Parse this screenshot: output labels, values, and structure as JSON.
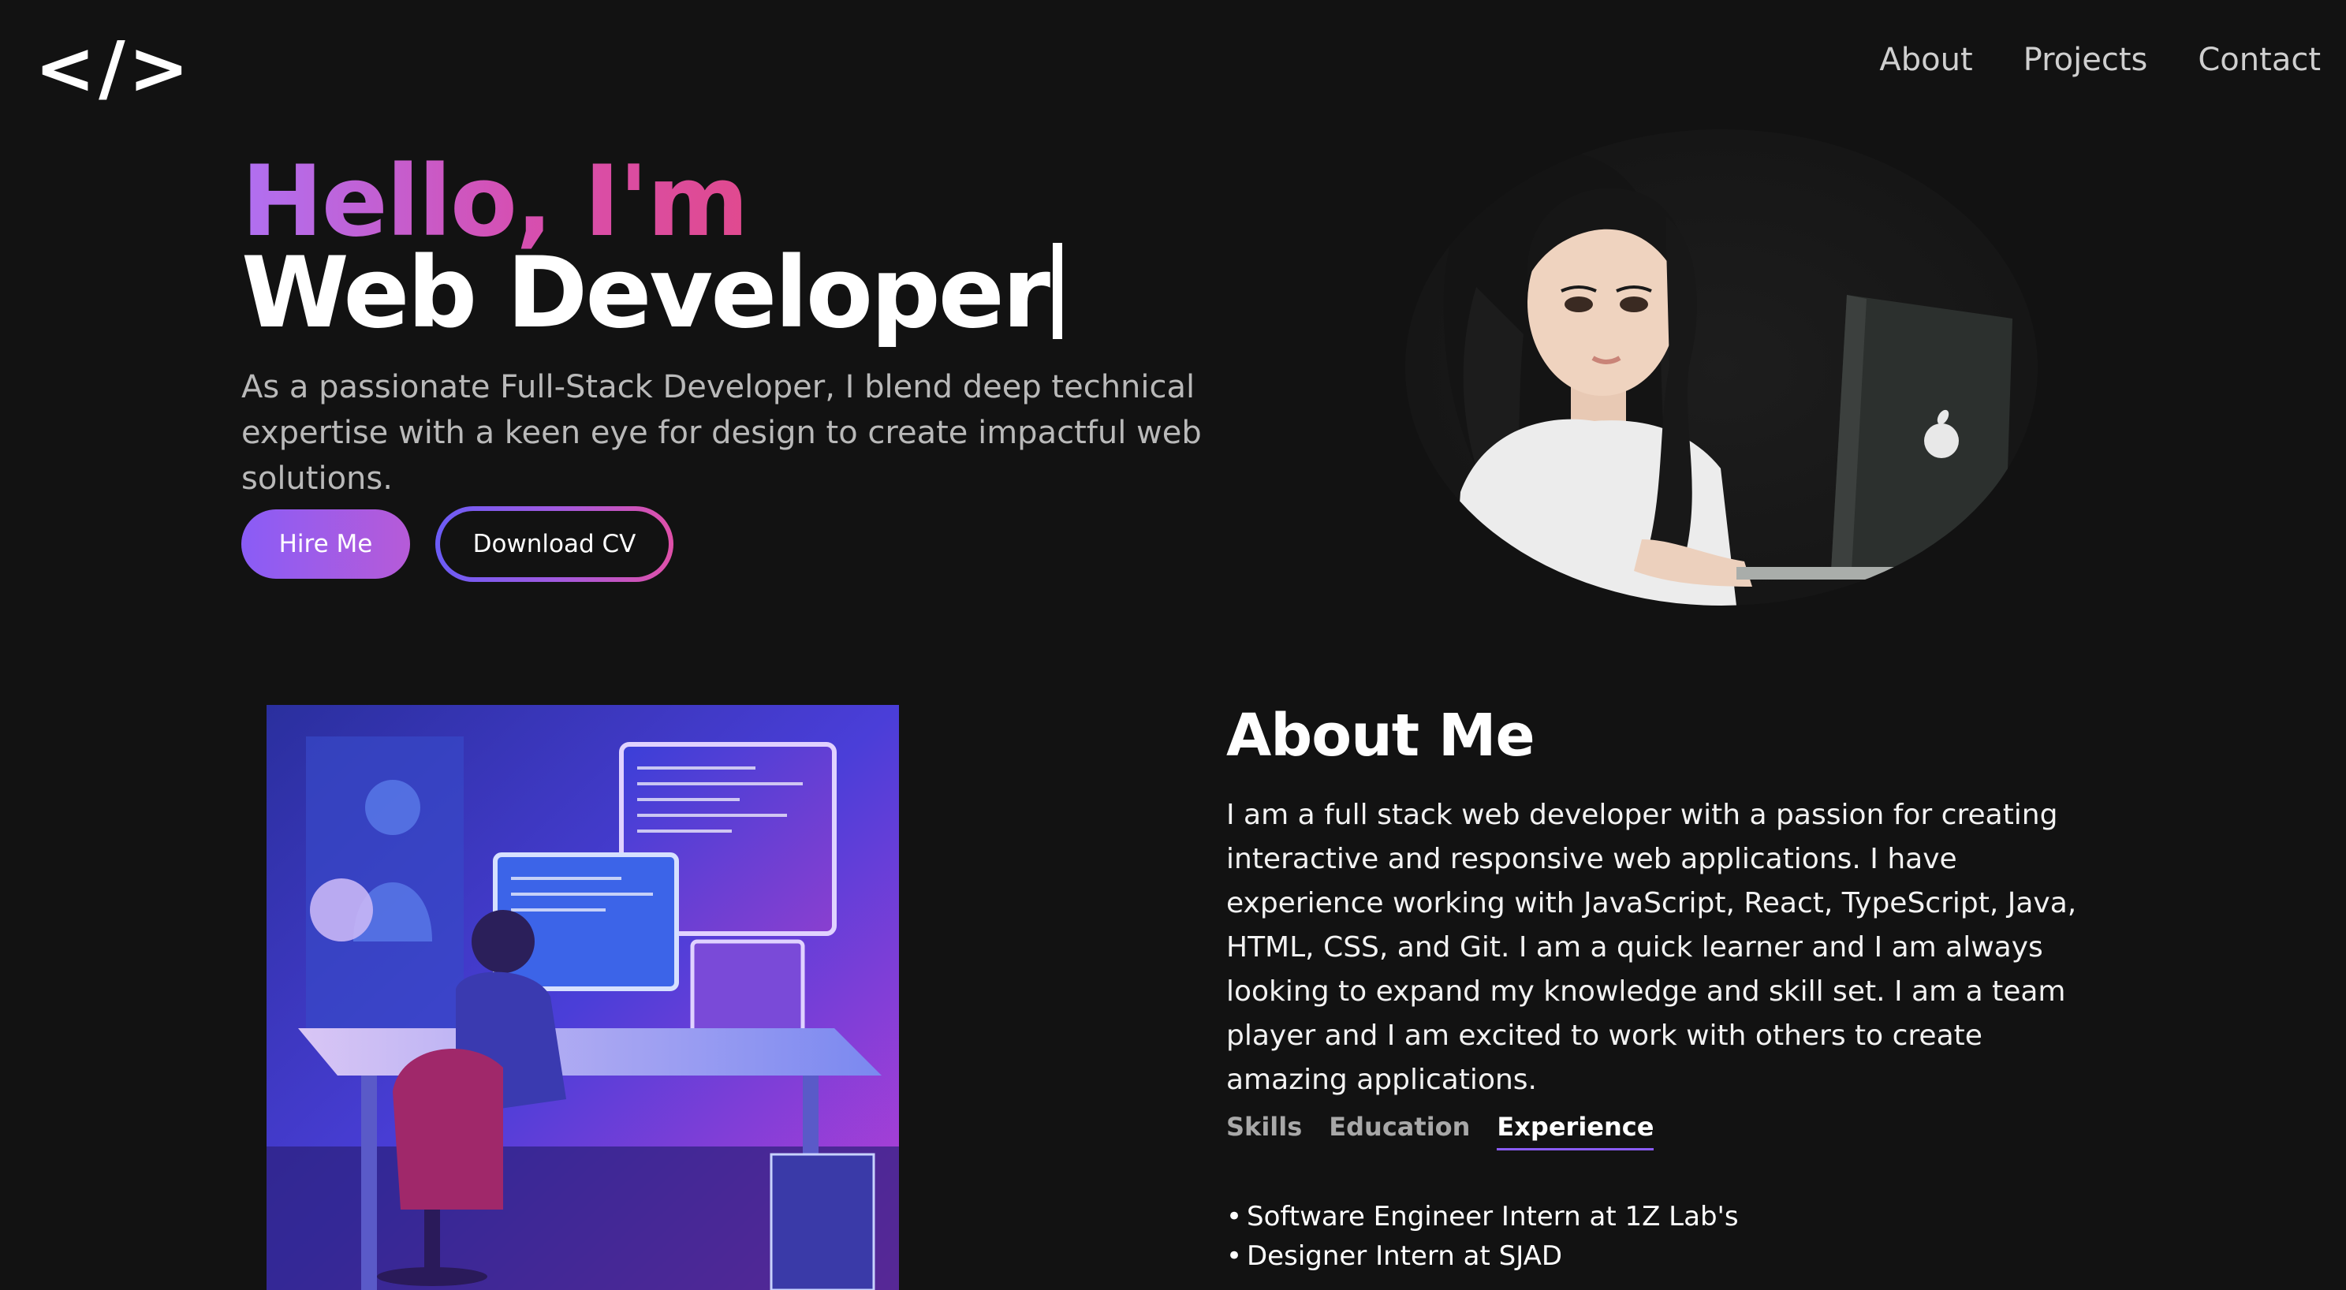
{
  "header": {
    "logo_text": "</>",
    "nav": [
      {
        "label": "About"
      },
      {
        "label": "Projects"
      },
      {
        "label": "Contact"
      }
    ]
  },
  "hero": {
    "greeting": "Hello, I'm",
    "title": "Web Developer",
    "description": "As a passionate Full-Stack Developer, I blend deep technical expertise with a keen eye for design to create impactful web solutions.",
    "hire_button": "Hire Me",
    "cv_button": "Download CV"
  },
  "about": {
    "heading": "About Me",
    "body": "I am a full stack web developer with a passion for creating interactive and responsive web applications. I have experience working with JavaScript, React, TypeScript, Java, HTML, CSS, and Git. I am a quick learner and I am always looking to expand my knowledge and skill set. I am a team player and I am excited to work with others to create amazing applications.",
    "tabs": [
      {
        "label": "Skills"
      },
      {
        "label": "Education"
      },
      {
        "label": "Experience"
      }
    ],
    "active_tab": "Experience",
    "experience": [
      "Software Engineer Intern at 1Z Lab's",
      "Designer Intern at SJAD"
    ]
  },
  "colors": {
    "background": "#121212",
    "accent_purple": "#8a5cf6",
    "accent_pink": "#e04a8f"
  }
}
